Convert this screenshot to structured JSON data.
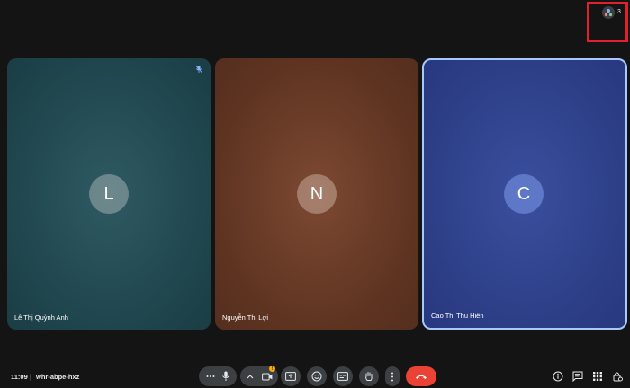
{
  "participants": [
    {
      "initial": "L",
      "name": "Lê Thị Quỳnh Anh",
      "muted": true
    },
    {
      "initial": "N",
      "name": "Nguyễn Thị Lợi",
      "muted": false
    },
    {
      "initial": "C",
      "name": "Cao Thị Thu Hiền",
      "muted": false,
      "active_speaker": true
    }
  ],
  "top_right": {
    "participant_count": "3"
  },
  "meeting": {
    "time": "11:09",
    "separator": "|",
    "code": "whr-abpe-hxz"
  },
  "controls": {
    "more_audio_icon": "ellipsis-icon",
    "mic_icon": "microphone-icon",
    "camera_options_icon": "chevron-up-icon",
    "camera_icon": "camera-icon",
    "camera_warning_badge": "!",
    "present_icon": "present-screen-icon",
    "reactions_icon": "emoji-icon",
    "captions_icon": "captions-icon",
    "raise_hand_icon": "hand-icon",
    "more_options_icon": "more-vert-icon",
    "end_call_icon": "end-call-icon"
  },
  "right_controls": [
    "info-icon",
    "chat-icon",
    "activities-icon",
    "host-controls-icon"
  ],
  "colors": {
    "end_call": "#ea4335",
    "active_speaker_border": "#a8c7fa",
    "warning": "#f9ab00",
    "highlight_box": "#e0202a"
  }
}
